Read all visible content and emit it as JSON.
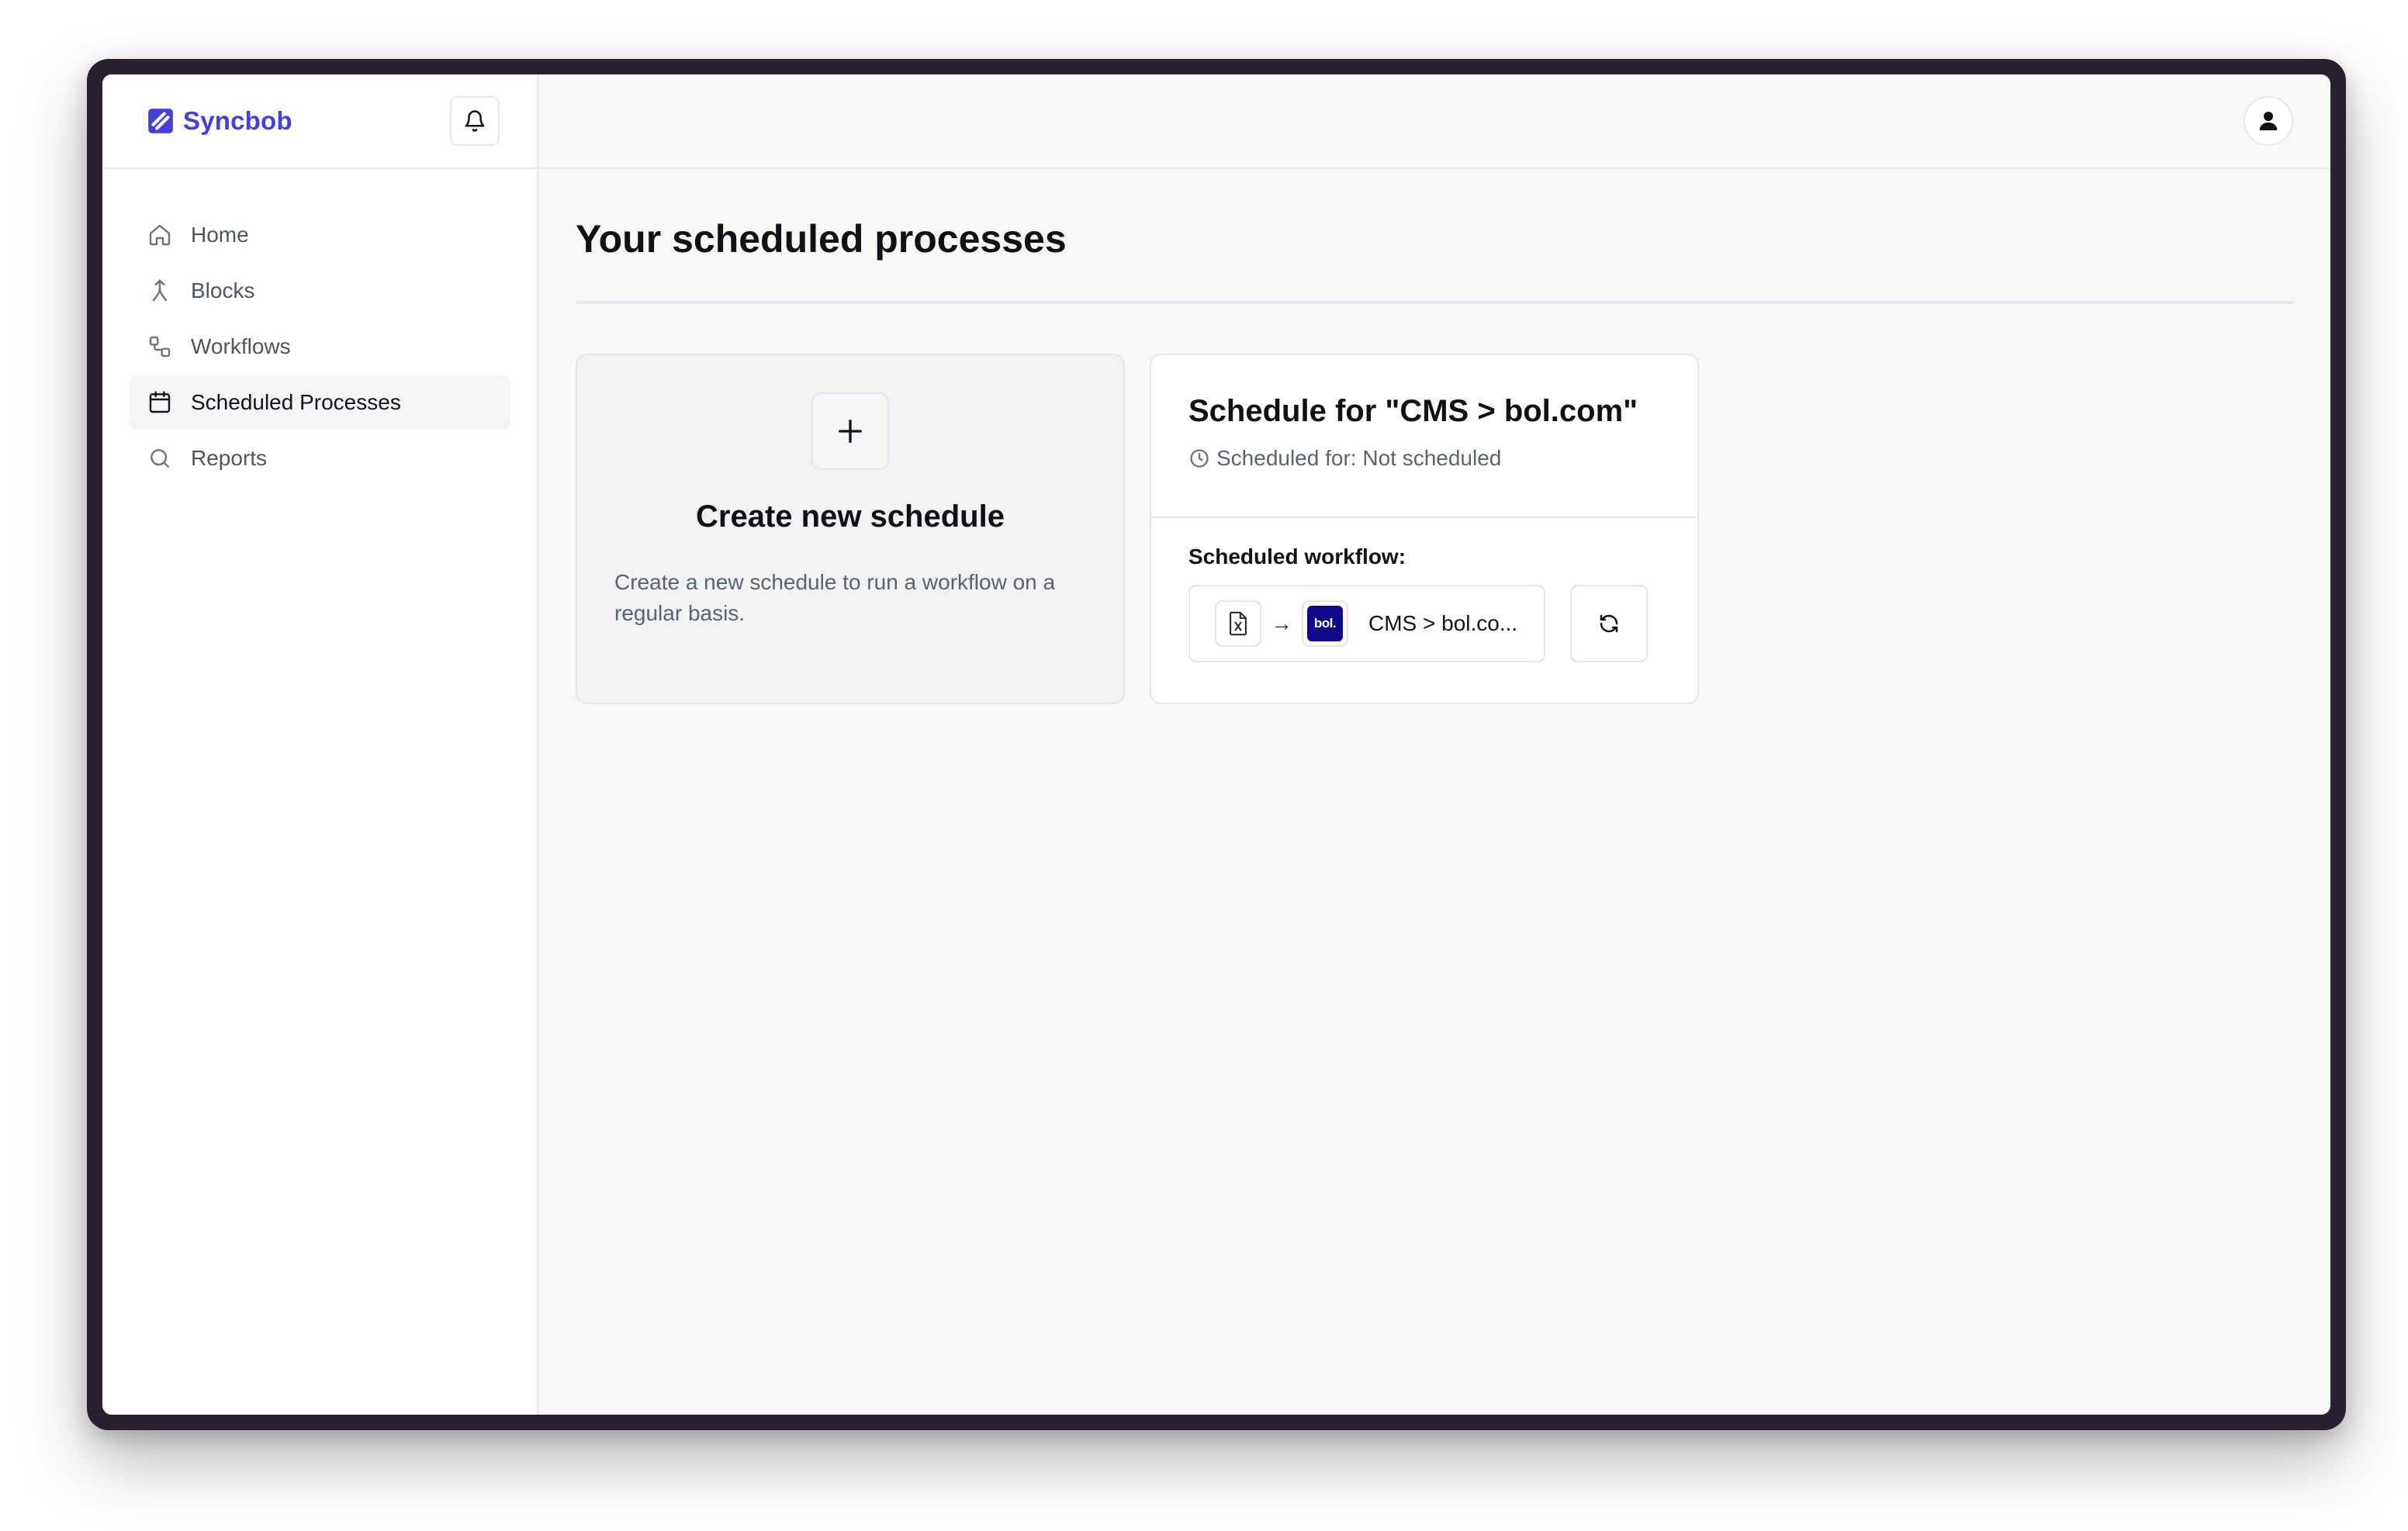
{
  "app": {
    "name": "Syncbob",
    "brand_color": "#4540d6"
  },
  "sidebar": {
    "items": [
      {
        "label": "Home",
        "icon": "home-icon",
        "active": false
      },
      {
        "label": "Blocks",
        "icon": "merge-icon",
        "active": false
      },
      {
        "label": "Workflows",
        "icon": "workflow-icon",
        "active": false
      },
      {
        "label": "Scheduled Processes",
        "icon": "calendar-icon",
        "active": true
      },
      {
        "label": "Reports",
        "icon": "search-icon",
        "active": false
      }
    ]
  },
  "header": {
    "notifications_icon": "bell-icon",
    "profile_icon": "user-icon"
  },
  "main": {
    "title": "Your scheduled processes",
    "new_card": {
      "title": "Create new schedule",
      "description": "Create a new schedule to run a workflow on a regular basis."
    },
    "schedule_card": {
      "title": "Schedule for \"CMS > bol.com\"",
      "scheduled_for": "Scheduled for: Not scheduled",
      "workflow_label": "Scheduled workflow:",
      "workflow_name": "CMS > bol.co...",
      "arrow": "→",
      "target_logo_text": "bol."
    }
  }
}
